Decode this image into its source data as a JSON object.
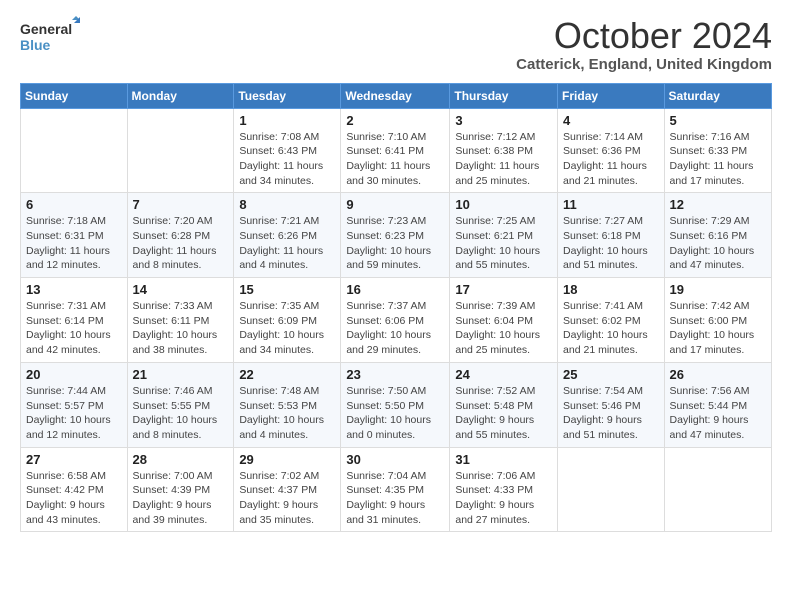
{
  "header": {
    "logo_line1": "General",
    "logo_line2": "Blue",
    "main_title": "October 2024",
    "subtitle": "Catterick, England, United Kingdom"
  },
  "days_of_week": [
    "Sunday",
    "Monday",
    "Tuesday",
    "Wednesday",
    "Thursday",
    "Friday",
    "Saturday"
  ],
  "weeks": [
    [
      {
        "day": "",
        "info": ""
      },
      {
        "day": "",
        "info": ""
      },
      {
        "day": "1",
        "info": "Sunrise: 7:08 AM\nSunset: 6:43 PM\nDaylight: 11 hours and 34 minutes."
      },
      {
        "day": "2",
        "info": "Sunrise: 7:10 AM\nSunset: 6:41 PM\nDaylight: 11 hours and 30 minutes."
      },
      {
        "day": "3",
        "info": "Sunrise: 7:12 AM\nSunset: 6:38 PM\nDaylight: 11 hours and 25 minutes."
      },
      {
        "day": "4",
        "info": "Sunrise: 7:14 AM\nSunset: 6:36 PM\nDaylight: 11 hours and 21 minutes."
      },
      {
        "day": "5",
        "info": "Sunrise: 7:16 AM\nSunset: 6:33 PM\nDaylight: 11 hours and 17 minutes."
      }
    ],
    [
      {
        "day": "6",
        "info": "Sunrise: 7:18 AM\nSunset: 6:31 PM\nDaylight: 11 hours and 12 minutes."
      },
      {
        "day": "7",
        "info": "Sunrise: 7:20 AM\nSunset: 6:28 PM\nDaylight: 11 hours and 8 minutes."
      },
      {
        "day": "8",
        "info": "Sunrise: 7:21 AM\nSunset: 6:26 PM\nDaylight: 11 hours and 4 minutes."
      },
      {
        "day": "9",
        "info": "Sunrise: 7:23 AM\nSunset: 6:23 PM\nDaylight: 10 hours and 59 minutes."
      },
      {
        "day": "10",
        "info": "Sunrise: 7:25 AM\nSunset: 6:21 PM\nDaylight: 10 hours and 55 minutes."
      },
      {
        "day": "11",
        "info": "Sunrise: 7:27 AM\nSunset: 6:18 PM\nDaylight: 10 hours and 51 minutes."
      },
      {
        "day": "12",
        "info": "Sunrise: 7:29 AM\nSunset: 6:16 PM\nDaylight: 10 hours and 47 minutes."
      }
    ],
    [
      {
        "day": "13",
        "info": "Sunrise: 7:31 AM\nSunset: 6:14 PM\nDaylight: 10 hours and 42 minutes."
      },
      {
        "day": "14",
        "info": "Sunrise: 7:33 AM\nSunset: 6:11 PM\nDaylight: 10 hours and 38 minutes."
      },
      {
        "day": "15",
        "info": "Sunrise: 7:35 AM\nSunset: 6:09 PM\nDaylight: 10 hours and 34 minutes."
      },
      {
        "day": "16",
        "info": "Sunrise: 7:37 AM\nSunset: 6:06 PM\nDaylight: 10 hours and 29 minutes."
      },
      {
        "day": "17",
        "info": "Sunrise: 7:39 AM\nSunset: 6:04 PM\nDaylight: 10 hours and 25 minutes."
      },
      {
        "day": "18",
        "info": "Sunrise: 7:41 AM\nSunset: 6:02 PM\nDaylight: 10 hours and 21 minutes."
      },
      {
        "day": "19",
        "info": "Sunrise: 7:42 AM\nSunset: 6:00 PM\nDaylight: 10 hours and 17 minutes."
      }
    ],
    [
      {
        "day": "20",
        "info": "Sunrise: 7:44 AM\nSunset: 5:57 PM\nDaylight: 10 hours and 12 minutes."
      },
      {
        "day": "21",
        "info": "Sunrise: 7:46 AM\nSunset: 5:55 PM\nDaylight: 10 hours and 8 minutes."
      },
      {
        "day": "22",
        "info": "Sunrise: 7:48 AM\nSunset: 5:53 PM\nDaylight: 10 hours and 4 minutes."
      },
      {
        "day": "23",
        "info": "Sunrise: 7:50 AM\nSunset: 5:50 PM\nDaylight: 10 hours and 0 minutes."
      },
      {
        "day": "24",
        "info": "Sunrise: 7:52 AM\nSunset: 5:48 PM\nDaylight: 9 hours and 55 minutes."
      },
      {
        "day": "25",
        "info": "Sunrise: 7:54 AM\nSunset: 5:46 PM\nDaylight: 9 hours and 51 minutes."
      },
      {
        "day": "26",
        "info": "Sunrise: 7:56 AM\nSunset: 5:44 PM\nDaylight: 9 hours and 47 minutes."
      }
    ],
    [
      {
        "day": "27",
        "info": "Sunrise: 6:58 AM\nSunset: 4:42 PM\nDaylight: 9 hours and 43 minutes."
      },
      {
        "day": "28",
        "info": "Sunrise: 7:00 AM\nSunset: 4:39 PM\nDaylight: 9 hours and 39 minutes."
      },
      {
        "day": "29",
        "info": "Sunrise: 7:02 AM\nSunset: 4:37 PM\nDaylight: 9 hours and 35 minutes."
      },
      {
        "day": "30",
        "info": "Sunrise: 7:04 AM\nSunset: 4:35 PM\nDaylight: 9 hours and 31 minutes."
      },
      {
        "day": "31",
        "info": "Sunrise: 7:06 AM\nSunset: 4:33 PM\nDaylight: 9 hours and 27 minutes."
      },
      {
        "day": "",
        "info": ""
      },
      {
        "day": "",
        "info": ""
      }
    ]
  ]
}
